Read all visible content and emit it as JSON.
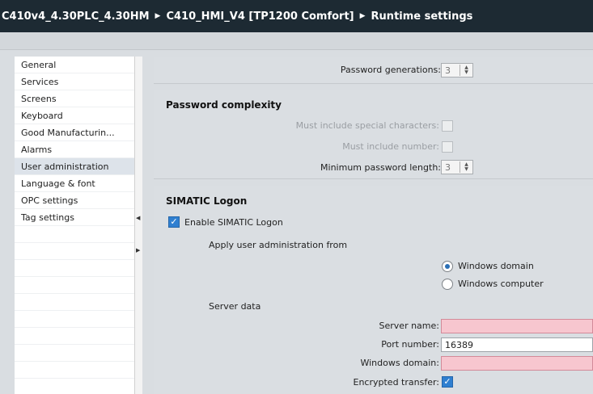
{
  "breadcrumb": {
    "item1": "C410v4_4.30PLC_4.30HM",
    "item2": "C410_HMI_V4 [TP1200 Comfort]",
    "item3": "Runtime settings"
  },
  "sidebar": {
    "items": [
      {
        "label": "General"
      },
      {
        "label": "Services"
      },
      {
        "label": "Screens"
      },
      {
        "label": "Keyboard"
      },
      {
        "label": "Good Manufacturin..."
      },
      {
        "label": "Alarms"
      },
      {
        "label": "User administration"
      },
      {
        "label": "Language & font"
      },
      {
        "label": "OPC settings"
      },
      {
        "label": "Tag settings"
      }
    ],
    "selected": "User administration"
  },
  "password_generations": {
    "label": "Password generations:",
    "value": "3"
  },
  "password_complexity": {
    "title": "Password complexity",
    "special_chars_label": "Must include special characters:",
    "number_label": "Must include number:",
    "min_length_label": "Minimum password length:",
    "min_length_value": "3"
  },
  "simatic_logon": {
    "title": "SIMATIC Logon",
    "enable_label": "Enable SIMATIC Logon",
    "enabled": true,
    "apply_label": "Apply user administration from",
    "option_domain": "Windows domain",
    "option_computer": "Windows computer",
    "selected_option": "Windows domain",
    "server_data_label": "Server data",
    "server_name_label": "Server name:",
    "server_name_value": "",
    "port_label": "Port number:",
    "port_value": "16389",
    "windows_domain_label": "Windows domain:",
    "windows_domain_value": "",
    "encrypted_label": "Encrypted transfer:",
    "encrypted": true
  },
  "colors": {
    "titlebar": "#1d2a33",
    "panel": "#dadee2",
    "invalid_field": "#f7c6cf",
    "checkbox_accent": "#2f7fd0"
  }
}
